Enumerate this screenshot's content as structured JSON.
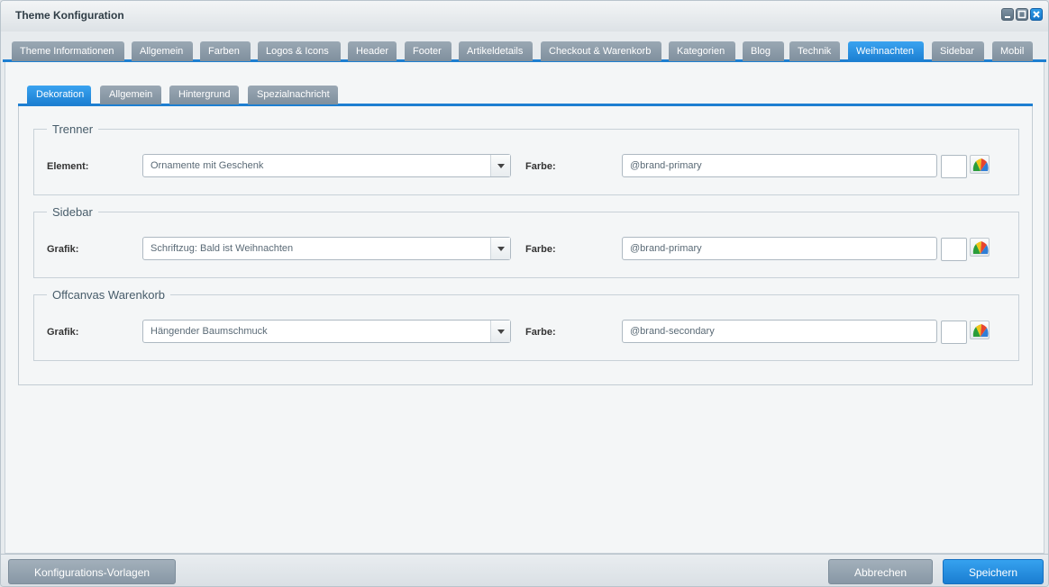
{
  "window": {
    "title": "Theme Konfiguration"
  },
  "tabs": [
    "Theme Informationen",
    "Allgemein",
    "Farben",
    "Logos & Icons",
    "Header",
    "Footer",
    "Artikeldetails",
    "Checkout & Warenkorb",
    "Kategorien",
    "Blog",
    "Technik",
    "Weihnachten",
    "Sidebar",
    "Mobil"
  ],
  "active_tab": "Weihnachten",
  "subtabs": [
    "Dekoration",
    "Allgemein",
    "Hintergrund",
    "Spezialnachricht"
  ],
  "active_subtab": "Dekoration",
  "sections": [
    {
      "legend": "Trenner",
      "field_label": "Element:",
      "select_value": "Ornamente mit Geschenk",
      "color_label": "Farbe:",
      "color_value": "@brand-primary"
    },
    {
      "legend": "Sidebar",
      "field_label": "Grafik:",
      "select_value": "Schriftzug: Bald ist Weihnachten",
      "color_label": "Farbe:",
      "color_value": "@brand-primary"
    },
    {
      "legend": "Offcanvas Warenkorb",
      "field_label": "Grafik:",
      "select_value": "Hängender Baumschmuck",
      "color_label": "Farbe:",
      "color_value": "@brand-secondary"
    }
  ],
  "footer": {
    "templates_label": "Konfigurations-Vorlagen",
    "cancel_label": "Abbrechen",
    "save_label": "Speichern"
  },
  "colors": {
    "accent": "#1e7fd1",
    "tab_inactive": "#8b9aa7"
  },
  "icons": [
    "minimize-icon",
    "maximize-icon",
    "close-icon",
    "chevron-down-icon",
    "color-picker-icon"
  ]
}
